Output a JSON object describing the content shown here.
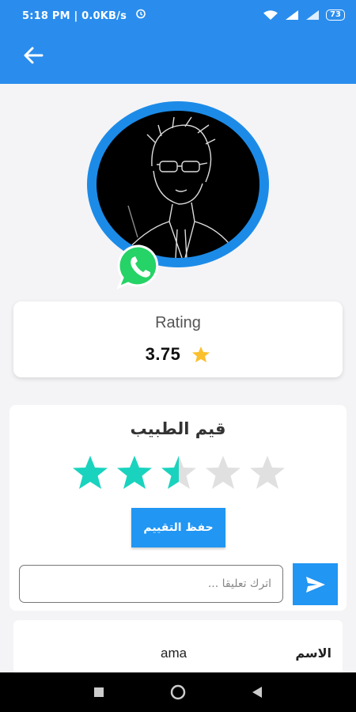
{
  "status_bar": {
    "time_text": "5:18 PM | 0.0KB/s",
    "battery_level": "73"
  },
  "rating_card": {
    "title": "Rating",
    "value": "3.75"
  },
  "rate_doctor": {
    "title": "قيم الطبيب",
    "stars_total": 5,
    "stars_value": 2.5,
    "save_label": "حفظ التقييم",
    "comment_placeholder": "اترك تعليقا ...",
    "comment_value": ""
  },
  "info": {
    "name_label": "الاسم",
    "name_value": "ama"
  },
  "colors": {
    "primary": "#2196f3",
    "status_bar": "#2a8ded",
    "star_active": "#19d3be",
    "star_inactive": "#e0e0e0",
    "rating_star": "#fbc02d",
    "whatsapp": "#25d366"
  },
  "icons": {
    "back": "arrow-left-icon",
    "send": "send-icon",
    "whatsapp": "whatsapp-icon",
    "rating_star": "star-icon"
  }
}
